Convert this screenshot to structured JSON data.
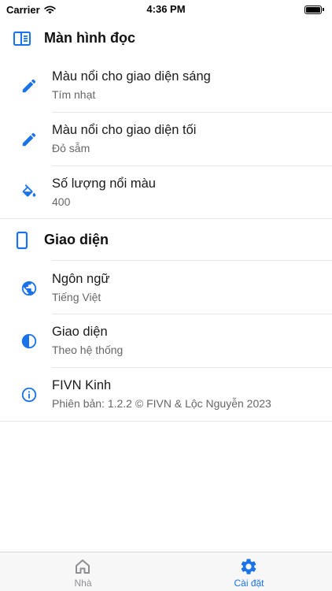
{
  "status": {
    "carrier": "Carrier",
    "time": "4:36 PM"
  },
  "colors": {
    "accent": "#1a73e8",
    "inactive": "#8e8e93"
  },
  "sections": [
    {
      "title": "Màn hình đọc",
      "icon": "reader-icon",
      "items": [
        {
          "title": "Màu nổi cho giao diện sáng",
          "subtitle": "Tím nhạt",
          "icon": "pencil-icon"
        },
        {
          "title": "Màu nổi cho giao diện tối",
          "subtitle": "Đỏ sẫm",
          "icon": "pencil-icon"
        },
        {
          "title": "Số lượng nổi màu",
          "subtitle": "400",
          "icon": "paint-bucket-icon"
        }
      ]
    },
    {
      "title": "Giao diện",
      "icon": "phone-icon",
      "items": [
        {
          "title": "Ngôn ngữ",
          "subtitle": "Tiếng Việt",
          "icon": "globe-icon"
        },
        {
          "title": "Giao diện",
          "subtitle": "Theo hệ thống",
          "icon": "contrast-icon"
        },
        {
          "title": "FIVN Kinh",
          "subtitle": "Phiên bản: 1.2.2 © FIVN & Lộc Nguyễn 2023",
          "icon": "info-icon"
        }
      ]
    }
  ],
  "tabs": [
    {
      "label": "Nhà",
      "icon": "home-icon",
      "active": false
    },
    {
      "label": "Cài đặt",
      "icon": "gear-icon",
      "active": true
    }
  ]
}
